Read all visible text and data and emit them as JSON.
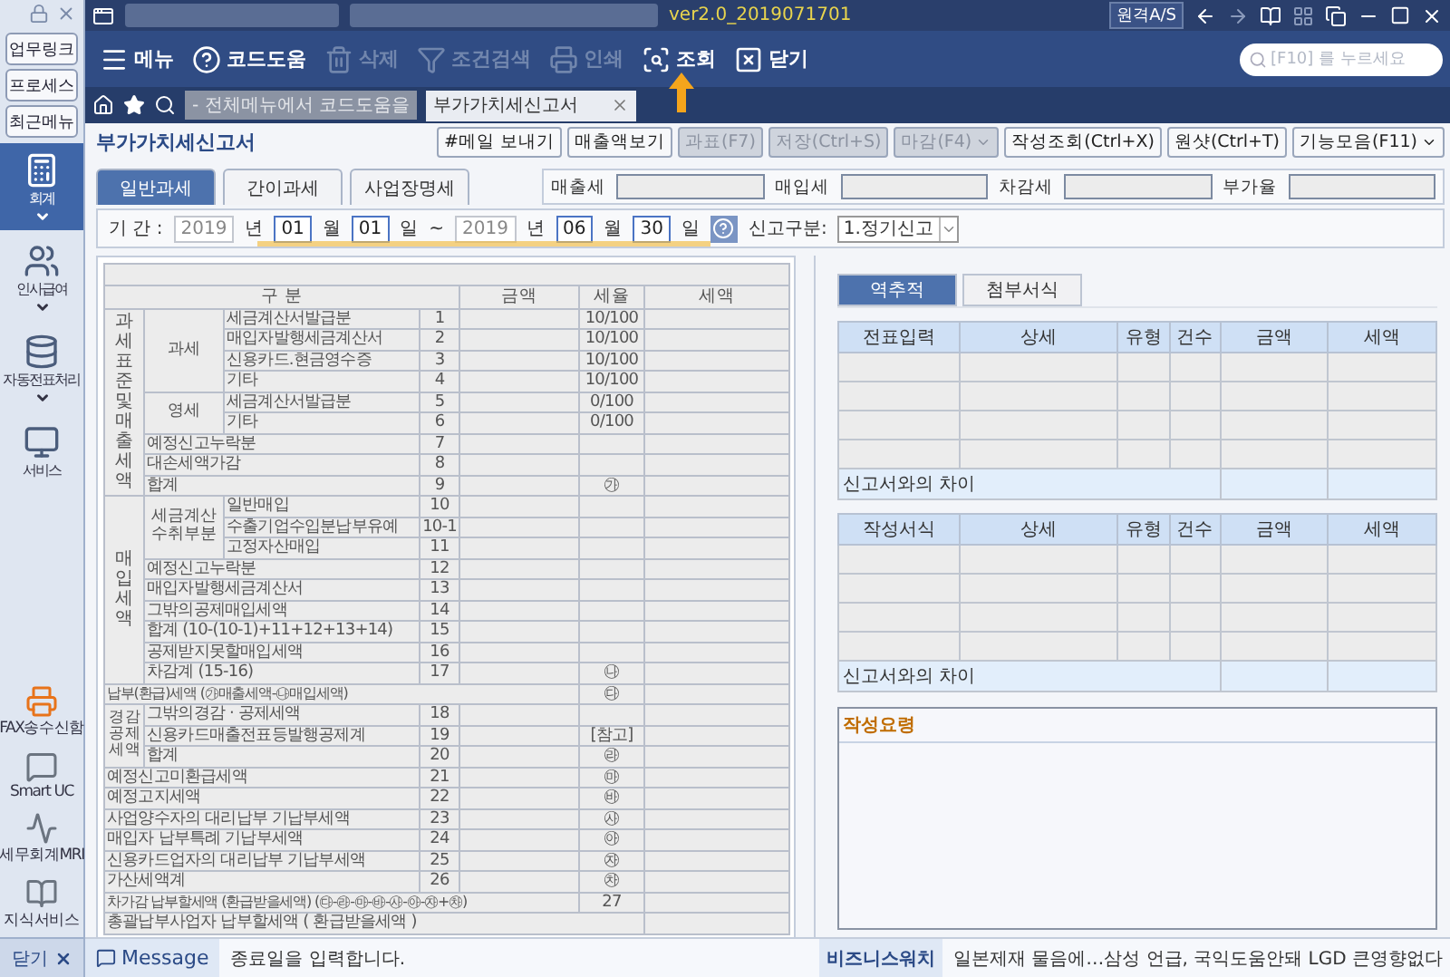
{
  "app": {
    "version": "ver2.0_2019071701",
    "remote": "원격A/S"
  },
  "quick_links": [
    "업무링크",
    "프로세스",
    "최근메뉴"
  ],
  "sidebar": {
    "items": [
      {
        "label": "회계",
        "selected": true,
        "expandable": true
      },
      {
        "label": "인사급여",
        "selected": false,
        "expandable": true
      },
      {
        "label": "자동전표처리",
        "selected": false,
        "expandable": true
      },
      {
        "label": "서비스",
        "selected": false,
        "expandable": false
      }
    ],
    "tools": [
      "FAX송수신함",
      "Smart UC",
      "세무회계MRI",
      "지식서비스"
    ],
    "close": "닫기"
  },
  "toolbar": [
    {
      "label": "메뉴",
      "disabled": false
    },
    {
      "label": "코드도움",
      "disabled": false
    },
    {
      "label": "삭제",
      "disabled": true
    },
    {
      "label": "조건검색",
      "disabled": true
    },
    {
      "label": "인쇄",
      "disabled": true
    },
    {
      "label": "조회",
      "disabled": false
    },
    {
      "label": "닫기",
      "disabled": false
    }
  ],
  "search": {
    "placeholder": "[F10] 를 누르세요"
  },
  "tab_hint": "- 전체메뉴에서 코드도움을",
  "tabs": [
    {
      "label": "부가가치세신고서",
      "selected": true
    }
  ],
  "form": {
    "title": "부가가치세신고서",
    "actions": [
      {
        "label": "#메일 보내기",
        "disabled": false,
        "dropdown": false
      },
      {
        "label": "매출액보기",
        "disabled": false,
        "dropdown": false
      },
      {
        "label": "과표(F7)",
        "disabled": true,
        "dropdown": false
      },
      {
        "label": "저장(Ctrl+S)",
        "disabled": true,
        "dropdown": false
      },
      {
        "label": "마감(F4)",
        "disabled": true,
        "dropdown": true
      },
      {
        "label": "작성조회(Ctrl+X)",
        "disabled": false,
        "dropdown": false
      },
      {
        "label": "원샷(Ctrl+T)",
        "disabled": false,
        "dropdown": false
      },
      {
        "label": "기능모음(F11)",
        "disabled": false,
        "dropdown": true
      }
    ],
    "tax_tabs": [
      {
        "label": "일반과세",
        "selected": true
      },
      {
        "label": "간이과세",
        "selected": false
      },
      {
        "label": "사업장명세",
        "selected": false
      }
    ],
    "summary_fields": [
      {
        "label": "매출세"
      },
      {
        "label": "매입세"
      },
      {
        "label": "차감세"
      },
      {
        "label": "부가율"
      }
    ],
    "period": {
      "label": "기 간 :",
      "parts": [
        {
          "kind": "fixed",
          "text": "2019"
        },
        {
          "kind": "unit",
          "text": "년"
        },
        {
          "kind": "input",
          "text": "01"
        },
        {
          "kind": "unit",
          "text": "월"
        },
        {
          "kind": "input",
          "text": "01"
        },
        {
          "kind": "unit",
          "text": "일"
        },
        {
          "kind": "unit",
          "text": "~"
        },
        {
          "kind": "fixed",
          "text": "2019"
        },
        {
          "kind": "unit",
          "text": "년"
        },
        {
          "kind": "input",
          "text": "06"
        },
        {
          "kind": "unit",
          "text": "월"
        },
        {
          "kind": "input",
          "text": "30"
        },
        {
          "kind": "unit",
          "text": "일"
        }
      ]
    },
    "report_type": {
      "label": "신고구분:",
      "value": "1.정기신고"
    }
  },
  "tax_table": {
    "columns": [
      "구 분",
      "금액",
      "세율",
      "세액"
    ],
    "sections": [
      {
        "kind": "vertical",
        "label": "과세표준및매출세액",
        "groups": [
          {
            "label": "과세",
            "rows": [
              {
                "kind": "line",
                "item": "세금계산서발급분",
                "no": "1",
                "rate": "10/100"
              },
              {
                "kind": "line",
                "item": "매입자발행세금계산서",
                "no": "2",
                "rate": "10/100"
              },
              {
                "kind": "line",
                "item": "신용카드.현금영수증",
                "no": "3",
                "rate": "10/100"
              },
              {
                "kind": "line",
                "item": "기타",
                "no": "4",
                "rate": "10/100"
              }
            ]
          },
          {
            "label": "영세",
            "rows": [
              {
                "kind": "line",
                "item": "세금계산서발급분",
                "no": "5",
                "rate": "0/100"
              },
              {
                "kind": "line",
                "item": "기타",
                "no": "6",
                "rate": "0/100"
              }
            ]
          },
          {
            "rows": [
              {
                "kind": "line",
                "item": "예정신고누락분",
                "no": "7"
              },
              {
                "kind": "line",
                "item": "대손세액가감",
                "no": "8"
              },
              {
                "kind": "line",
                "item": "합계",
                "no": "9",
                "rate": "㉮"
              }
            ]
          }
        ]
      },
      {
        "kind": "vertical",
        "label": "매입세액",
        "groups": [
          {
            "label": "세금계산수취부분",
            "rows": [
              {
                "kind": "line",
                "item": "일반매입",
                "no": "10"
              },
              {
                "kind": "line",
                "item": "수출기업수입분납부유예",
                "no": "10-1"
              },
              {
                "kind": "line",
                "item": "고정자산매입",
                "no": "11"
              }
            ]
          },
          {
            "rows": [
              {
                "kind": "line",
                "item": "예정신고누락분",
                "no": "12"
              },
              {
                "kind": "line",
                "item": "매입자발행세금계산서",
                "no": "13"
              },
              {
                "kind": "line",
                "item": "그밖의공제매입세액",
                "no": "14"
              },
              {
                "kind": "line",
                "item": "합계 (10-(10-1)+11+12+13+14)",
                "no": "15"
              },
              {
                "kind": "line",
                "item": "공제받지못할매입세액",
                "no": "16"
              },
              {
                "kind": "line",
                "item": "차감계 (15-16)",
                "no": "17",
                "rate": "㉯"
              }
            ]
          }
        ]
      },
      {
        "kind": "none",
        "groups": [
          {
            "rows": [
              {
                "kind": "long",
                "item": "납부(환급)세액 (㉮매출세액-㉯매입세액)",
                "rate": "㉰"
              }
            ]
          }
        ]
      },
      {
        "kind": "paired",
        "label": "경감공제세액",
        "groups": [
          {
            "rows": [
              {
                "kind": "line",
                "item": "그밖의경감 · 공제세액",
                "no": "18"
              },
              {
                "kind": "line",
                "item": "신용카드매출전표등발행공제계",
                "no": "19",
                "rate": "[참고]"
              },
              {
                "kind": "line",
                "item": "합계",
                "no": "20",
                "rate": "㉱"
              }
            ]
          }
        ]
      },
      {
        "kind": "none",
        "groups": [
          {
            "rows": [
              {
                "kind": "line",
                "item": "예정신고미환급세액",
                "no": "21",
                "rate": "㉲"
              },
              {
                "kind": "line",
                "item": "예정고지세액",
                "no": "22",
                "rate": "㉳"
              },
              {
                "kind": "line",
                "item": "사업양수자의 대리납부 기납부세액",
                "no": "23",
                "rate": "㉴"
              },
              {
                "kind": "line",
                "item": "매입자 납부특례 기납부세액",
                "no": "24",
                "rate": "㉵"
              },
              {
                "kind": "line",
                "item": "신용카드업자의 대리납부 기납부세액",
                "no": "25",
                "rate": "㉶"
              },
              {
                "kind": "line",
                "item": "가산세액계",
                "no": "26",
                "rate": "㉷"
              },
              {
                "kind": "long",
                "item": "차가감 납부할세액 (환급받을세액) (㉰-㉱-㉲-㉳-㉴-㉵-㉶+㉷)",
                "no": "27"
              },
              {
                "kind": "full",
                "item": "총괄납부사업자 납부할세액 ( 환급받을세액 )"
              }
            ]
          }
        ]
      }
    ]
  },
  "side_tabs": [
    {
      "label": "역추적",
      "selected": true
    },
    {
      "label": "첨부서식",
      "selected": false
    }
  ],
  "side_grids": [
    {
      "columns": [
        "전표입력",
        "상세",
        "유형",
        "건수",
        "금액",
        "세액"
      ],
      "footer": "신고서와의 차이"
    },
    {
      "columns": [
        "작성서식",
        "상세",
        "유형",
        "건수",
        "금액",
        "세액"
      ],
      "footer": "신고서와의 차이"
    }
  ],
  "guide": {
    "title": "작성요령"
  },
  "status": {
    "label": "Message",
    "text": "종료일을 입력합니다.",
    "news_source": "비즈니스워치",
    "news": "일본제재 물음에…삼성 언급, 국익도움안돼 LGD 큰영향없다"
  }
}
